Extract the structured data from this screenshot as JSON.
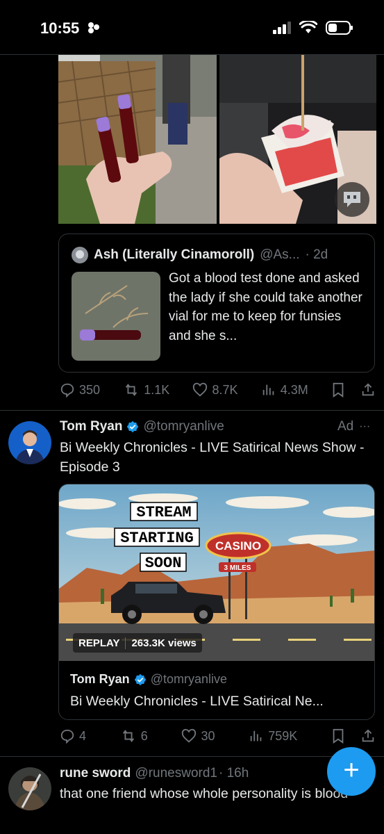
{
  "status_bar": {
    "time": "10:55"
  },
  "quoted_post": {
    "author_name": "Ash (Literally Cinamoroll)",
    "author_handle": "@As...",
    "age": "· 2d",
    "text": "Got a blood test done and asked the lady if she could take another vial for me to keep for funsies and she s..."
  },
  "post1_actions": {
    "replies": "350",
    "reposts": "1.1K",
    "likes": "8.7K",
    "views": "4.3M"
  },
  "ad_post": {
    "author_name": "Tom Ryan",
    "author_handle": "@tomryanlive",
    "ad_label": "Ad",
    "more": "···",
    "text": "Bi Weekly Chronicles - LIVE Satirical News Show - Episode 3",
    "thumbnail": {
      "line1": "STREAM",
      "line2": "STARTING",
      "line3": "SOON",
      "sign": "CASINO",
      "sign_sub": "3 MILES"
    },
    "replay_label": "REPLAY",
    "views_label": "263.3K views",
    "card_author": "Tom Ryan",
    "card_handle": "@tomryanlive",
    "card_title": "Bi Weekly Chronicles - LIVE Satirical Ne...",
    "actions": {
      "replies": "4",
      "reposts": "6",
      "likes": "30",
      "views": "759K"
    }
  },
  "post3": {
    "author_name": "rune sword",
    "author_handle": "@runesword1",
    "age": "· 16h",
    "text": "that one friend whose whole personality is blood"
  },
  "fab": {
    "label": "+"
  },
  "colors": {
    "accent": "#1d9bf0",
    "muted": "#71767b",
    "border": "#2f3336"
  }
}
